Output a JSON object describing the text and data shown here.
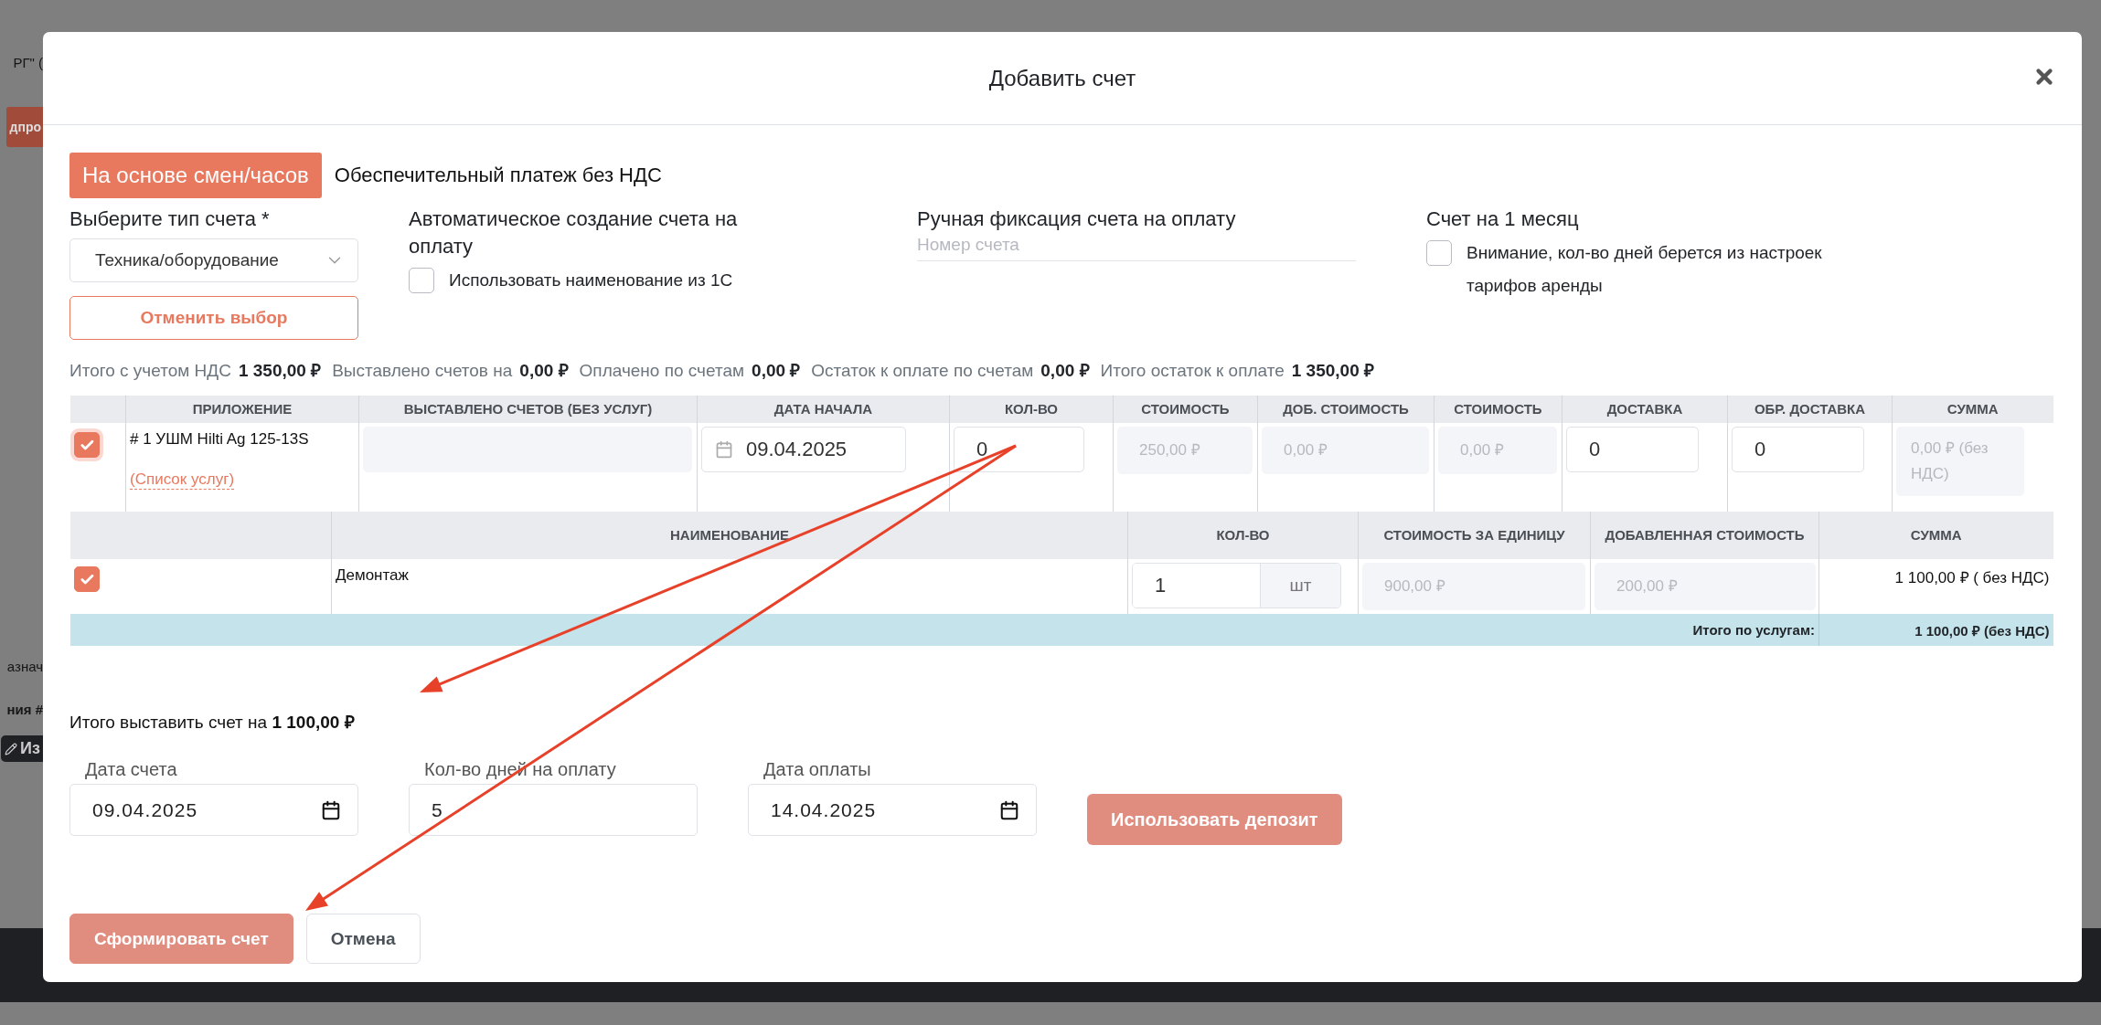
{
  "background": {
    "fragments": [
      {
        "kind": "text",
        "text": "РГ\" ("
      },
      {
        "kind": "button",
        "text": "дпро"
      },
      {
        "kind": "text",
        "text": "азнач"
      },
      {
        "kind": "bold",
        "text": "ния #"
      },
      {
        "kind": "badge",
        "text": "Из"
      }
    ]
  },
  "modal": {
    "title": "Добавить счет"
  },
  "mode_button": "На основе смен/часов",
  "mode_note": "Обеспечительный платеж без НДС",
  "invoice_type": {
    "label": "Выберите тип счета *",
    "value": "Техника/оборудование",
    "cancel_button": "Отменить выбор"
  },
  "auto_create": {
    "label": "Автоматическое создание счета на оплату",
    "checkbox": {
      "label": "Использовать наименование из 1С",
      "checked": false
    }
  },
  "manual": {
    "label": "Ручная фиксация счета на оплату",
    "placeholder": "Номер счета"
  },
  "month": {
    "label": "Счет на 1 месяц",
    "checkbox": {
      "label": "Внимание, кол-во дней берется из настроек тарифов аренды",
      "checked": false
    }
  },
  "summary": [
    {
      "label": "Итого с учетом НДС",
      "value": "1 350,00 ₽"
    },
    {
      "label": "Выставлено счетов на",
      "value": "0,00 ₽"
    },
    {
      "label": "Оплачено по счетам",
      "value": "0,00 ₽"
    },
    {
      "label": "Остаток к оплате по счетам",
      "value": "0,00 ₽"
    },
    {
      "label": "Итого остаток к оплате",
      "value": "1 350,00 ₽"
    }
  ],
  "items_table": {
    "columns": [
      "ПРИЛОЖЕНИЕ",
      "ВЫСТАВЛЕНО СЧЕТОВ (БЕЗ УСЛУГ)",
      "ДАТА НАЧАЛА",
      "КОЛ-ВО",
      "СТОИМОСТЬ",
      "ДОБ. СТОИМОСТЬ",
      "СТОИМОСТЬ",
      "ДОСТАВКА",
      "ОБР. ДОСТАВКА",
      "СУММА"
    ],
    "rows": [
      {
        "checked": true,
        "attachment": "# 1 УШМ Hilti Ag 125-13S",
        "services_link": "(Список услуг)",
        "start_date": "09.04.2025",
        "qty": "0",
        "cost": "250,00 ₽",
        "added_cost": "0,00 ₽",
        "cost_2": "0,00 ₽",
        "delivery": "0",
        "return_delivery": "0",
        "sum": "0,00 ₽ (без НДС)"
      }
    ]
  },
  "services_table": {
    "columns": [
      "НАИМЕНОВАНИЕ",
      "КОЛ-ВО",
      "СТОИМОСТЬ ЗА ЕДИНИЦУ",
      "ДОБАВЛЕННАЯ СТОИМОСТЬ",
      "СУММА"
    ],
    "rows": [
      {
        "checked": true,
        "name": "Демонтаж",
        "qty": "1",
        "unit": "шт",
        "unit_price": "900,00 ₽",
        "added": "200,00 ₽",
        "sum": "1 100,00 ₽ ( без НДС)"
      }
    ],
    "total_label": "Итого по услугам:",
    "total": "1 100,00 ₽ (без НДС)"
  },
  "invoice_total": "Итого выставить счет на **1 100,00 ₽**",
  "dates": [
    {
      "kind": "date",
      "label": "Дата счета",
      "value": "09.04.2025"
    },
    {
      "kind": "number",
      "label": "Кол-во дней на оплату",
      "value": "5"
    },
    {
      "kind": "date",
      "label": "Дата оплаты",
      "value": "14.04.2025"
    }
  ],
  "deposit_button": "Использовать депозит",
  "actions": [
    {
      "kind": "primary",
      "label": "Сформировать счет"
    },
    {
      "kind": "secondary",
      "label": "Отмена"
    }
  ]
}
